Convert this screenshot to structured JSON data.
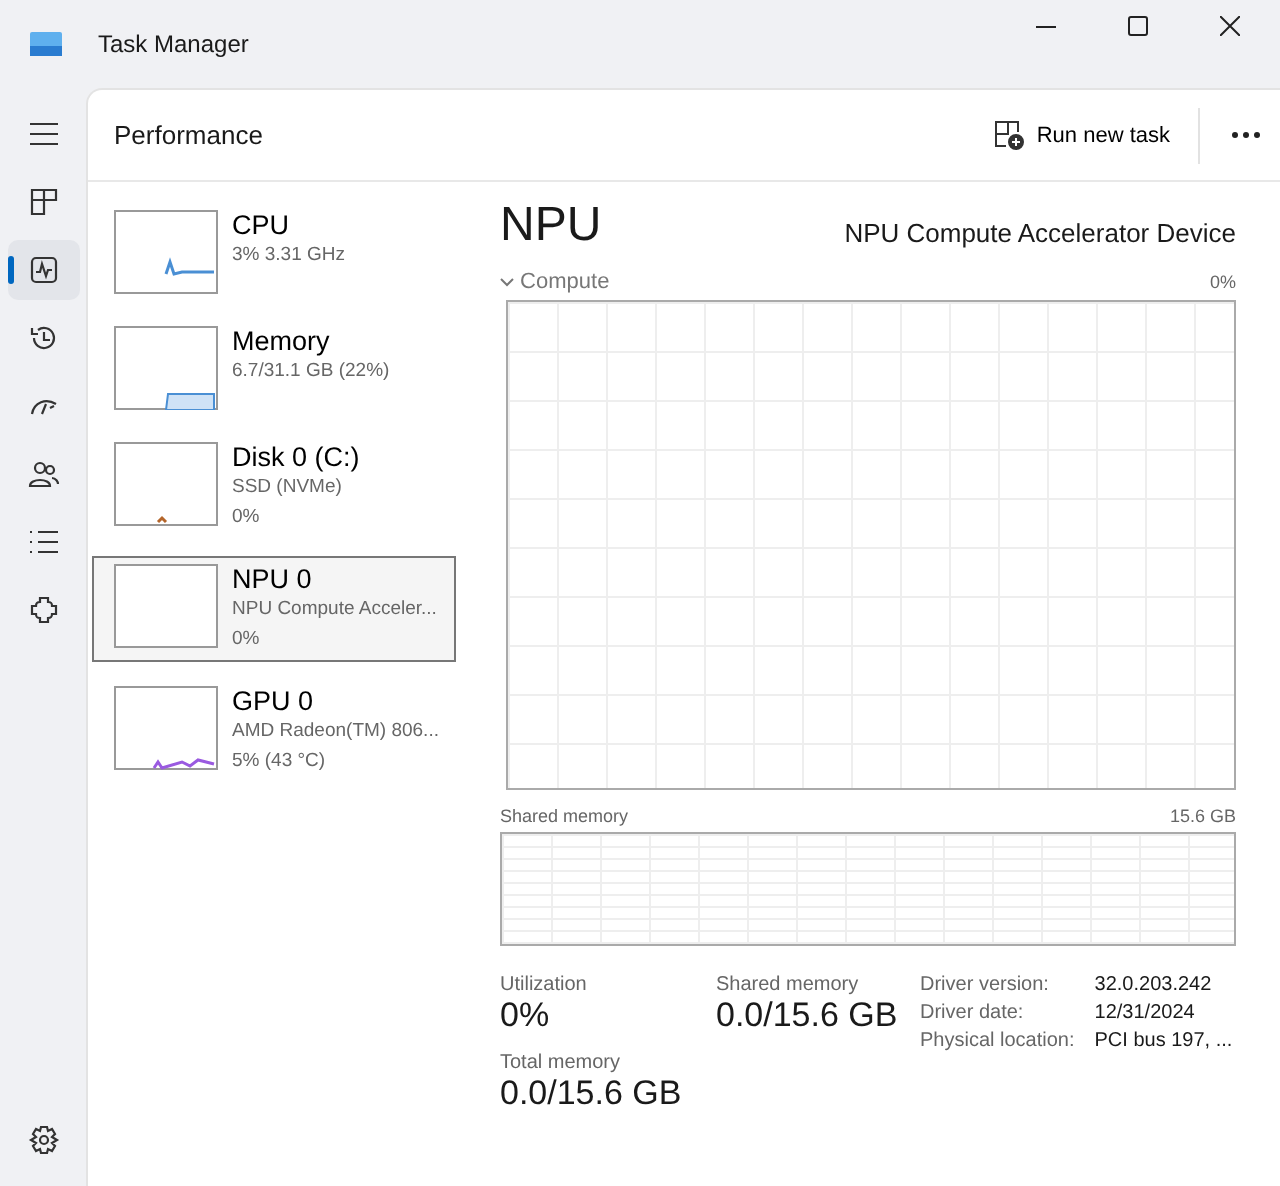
{
  "window": {
    "title": "Task Manager"
  },
  "nav": [
    {
      "selected": false
    },
    {
      "selected": false
    },
    {
      "selected": true
    },
    {
      "selected": false
    },
    {
      "selected": false
    },
    {
      "selected": false
    },
    {
      "selected": false
    },
    {
      "selected": false
    }
  ],
  "header": {
    "title": "Performance",
    "run_new_task": "Run new task"
  },
  "devices": [
    {
      "name": "CPU",
      "lines": [
        "3%  3.31 GHz"
      ],
      "selected": false,
      "color": "#4a8fd4"
    },
    {
      "name": "Memory",
      "lines": [
        "6.7/31.1 GB (22%)"
      ],
      "selected": false,
      "color": "#4a8fd4"
    },
    {
      "name": "Disk 0 (C:)",
      "lines": [
        "SSD (NVMe)",
        "0%"
      ],
      "selected": false,
      "color": "#b4652a"
    },
    {
      "name": "NPU 0",
      "lines": [
        "NPU Compute Acceler...",
        "0%"
      ],
      "selected": true
    },
    {
      "name": "GPU 0",
      "lines": [
        "AMD Radeon(TM) 806...",
        "5%  (43 °C)"
      ],
      "selected": false,
      "color": "#9a5ae0"
    }
  ],
  "detail": {
    "title": "NPU",
    "device": "NPU Compute Accelerator Device",
    "graph_label": "Compute",
    "graph_max": "0%",
    "memory_label": "Shared memory",
    "memory_max": "15.6 GB",
    "stats": [
      {
        "label": "Utilization",
        "value": "0%"
      },
      {
        "label": "Shared memory",
        "value": "0.0/15.6 GB"
      },
      {
        "label": "Total memory",
        "value": "0.0/15.6 GB"
      }
    ],
    "info": [
      {
        "label": "Driver version:",
        "value": "32.0.203.242"
      },
      {
        "label": "Driver date:",
        "value": "12/31/2024"
      },
      {
        "label": "Physical location:",
        "value": "PCI bus 197, ..."
      }
    ]
  }
}
